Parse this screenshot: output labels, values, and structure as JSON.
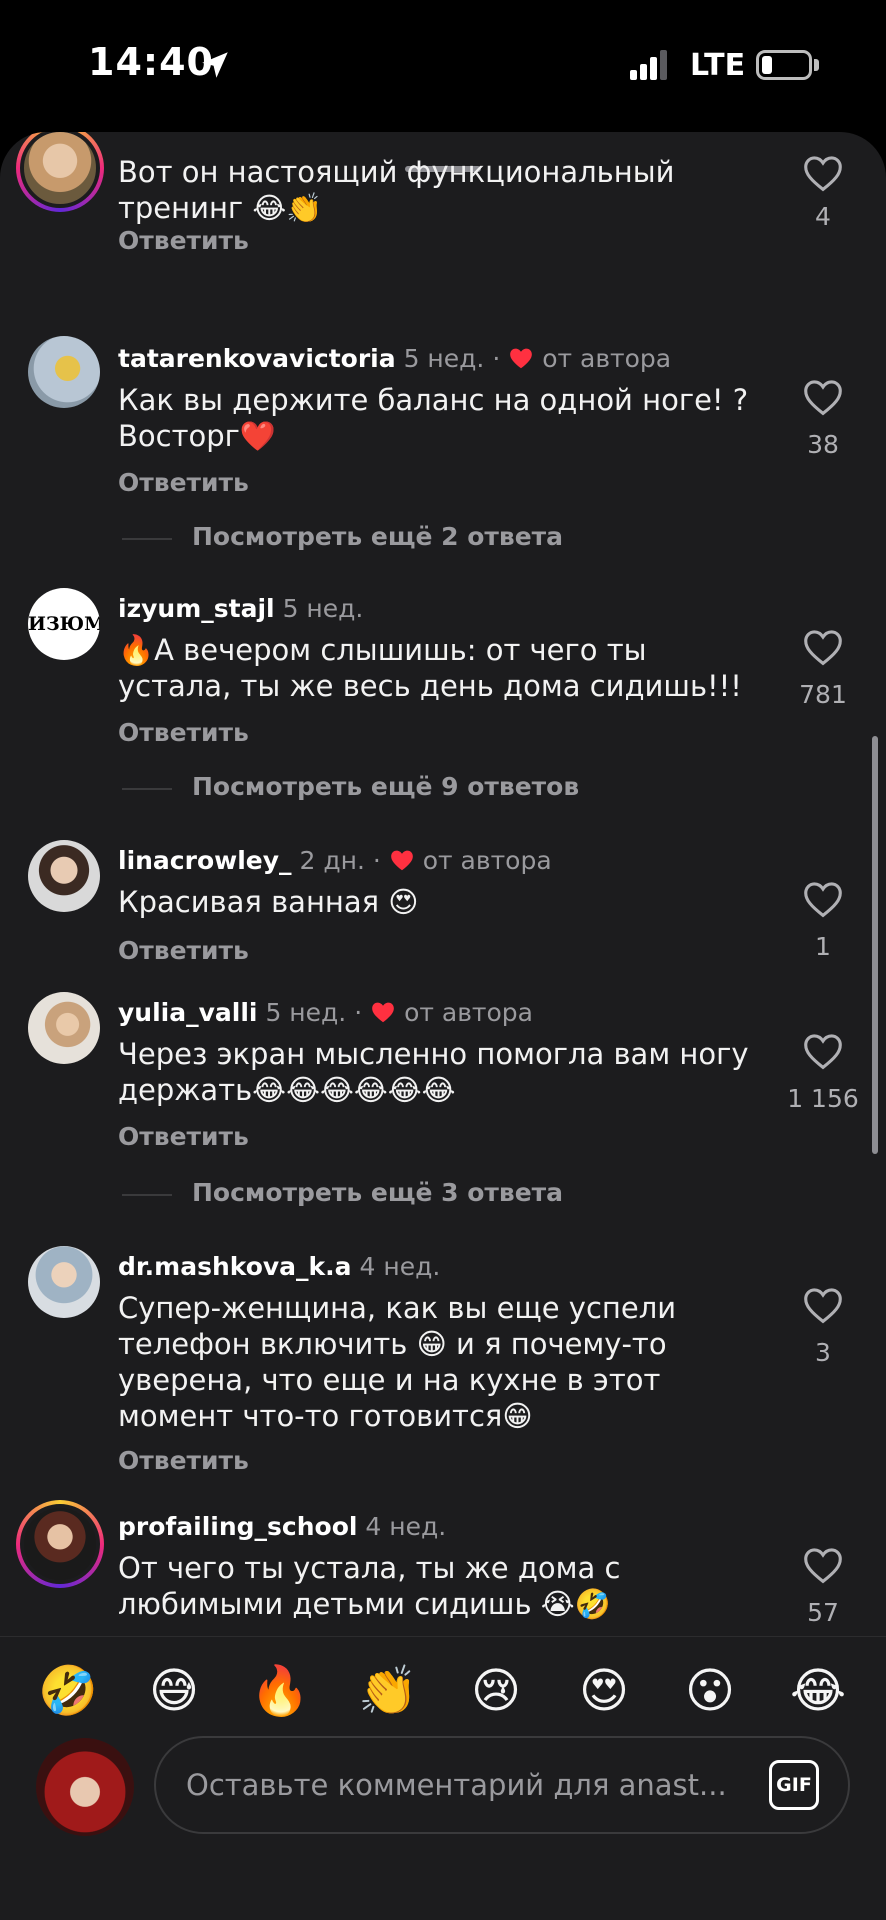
{
  "status_bar": {
    "time": "14:40",
    "network": "LTE"
  },
  "comments": [
    {
      "username": "",
      "ago": "",
      "by_author": "",
      "text": "Вот он настоящий функциональный тренинг 😂👏",
      "reply": "Ответить",
      "likes": "4"
    },
    {
      "username": "tatarenkovavictoria",
      "ago": "5 нед. ·",
      "by_author": "от автора",
      "text": "Как вы держите баланс на одной ноге! ? Восторг❤️",
      "reply": "Ответить",
      "likes": "38"
    },
    {
      "username": "izyum_stajl",
      "ago": "5 нед.",
      "by_author": "",
      "text": "🔥А вечером слышишь: от чего ты устала, ты же весь день дома сидишь!!!",
      "reply": "Ответить",
      "likes": "781"
    },
    {
      "username": "linacrowley_",
      "ago": "2 дн. ·",
      "by_author": "от автора",
      "text": "Красивая ванная 😍",
      "reply": "Ответить",
      "likes": "1"
    },
    {
      "username": "yulia_valli",
      "ago": "5 нед. ·",
      "by_author": "от автора",
      "text": "Через экран мысленно помогла вам ногу держать😂😂😂😂😂😂",
      "reply": "Ответить",
      "likes": "1 156"
    },
    {
      "username": "dr.mashkova_k.a",
      "ago": "4 нед.",
      "by_author": "",
      "text": "Супер-женщина, как вы еще успели телефон включить 😁 и я почему-то уверена, что еще и на кухне в этот момент что-то готовится😁",
      "reply": "Ответить",
      "likes": "3"
    },
    {
      "username": "profailing_school",
      "ago": "4 нед.",
      "by_author": "",
      "text": "От чего ты устала, ты же дома с любимыми детьми сидишь 😭🤣",
      "reply": "",
      "likes": "57"
    }
  ],
  "more_replies": [
    "Посмотреть ещё 2 ответа",
    "Посмотреть ещё 9 ответов",
    "Посмотреть ещё 3 ответа"
  ],
  "izyum_avatar_text": "ИЗЮМ",
  "emoji_bar": [
    "🤣",
    "😅",
    "🔥",
    "👏",
    "😢",
    "😍",
    "😮",
    "😂"
  ],
  "input": {
    "placeholder": "Оставьте комментарий для anast...",
    "gif_label": "GIF"
  }
}
